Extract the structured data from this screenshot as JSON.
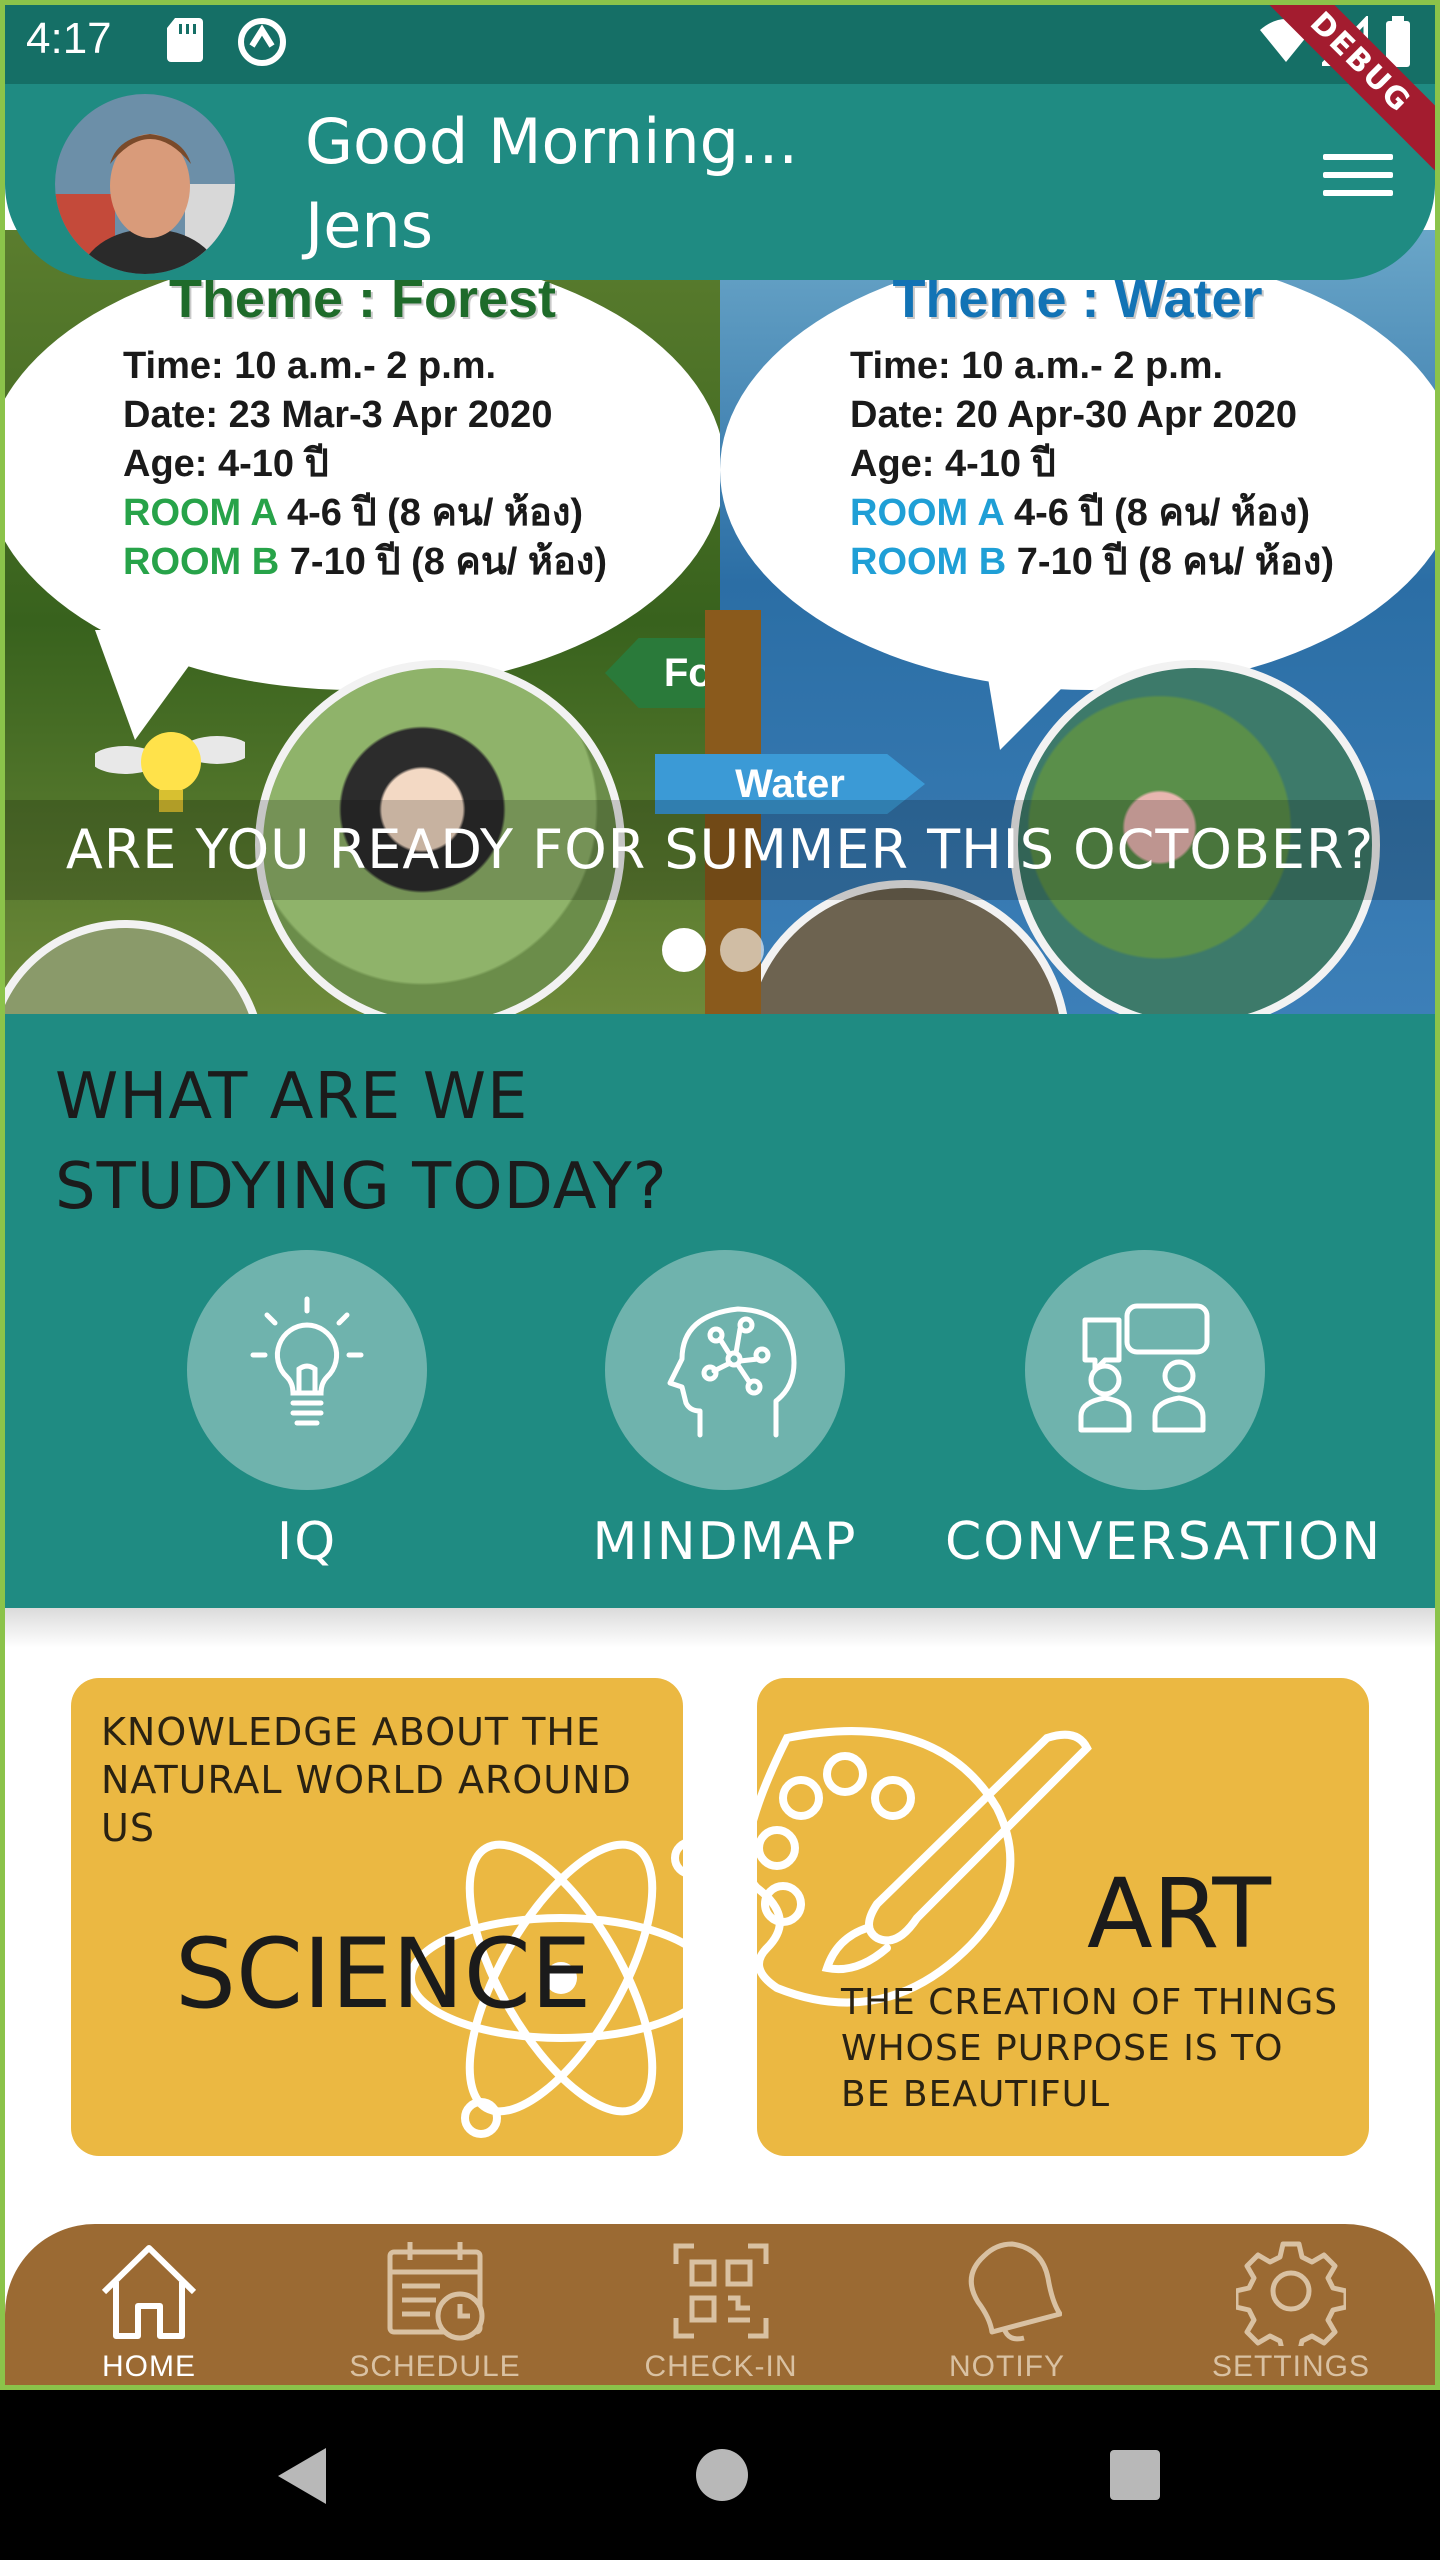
{
  "status_bar": {
    "time": "4:17",
    "icons": [
      "sd-card-icon",
      "sync-icon",
      "wifi-icon",
      "signal-icon",
      "battery-icon"
    ],
    "debug_label": "DEBUG"
  },
  "header": {
    "greeting": "Good Morning...",
    "user_name": "Jens"
  },
  "banner": {
    "caption": "ARE YOU READY FOR SUMMER THIS OCTOBER?",
    "slides_count": 2,
    "active_slide": 0,
    "forest": {
      "title": "Theme : Forest",
      "time": "Time: 10 a.m.- 2 p.m.",
      "date": "Date: 23 Mar-3 Apr 2020",
      "age": "Age: 4-10 ปี",
      "room_a_label": "ROOM A",
      "room_a_text": " 4-6 ปี  (8 คน/ ห้อง)",
      "room_b_label": "ROOM B",
      "room_b_text": " 7-10 ปี (8 คน/ ห้อง)",
      "sign": "Forest"
    },
    "water": {
      "title": "Theme : Water",
      "time": "Time: 10 a.m.- 2 p.m.",
      "date": "Date: 20 Apr-30 Apr 2020",
      "age": "Age: 4-10 ปี",
      "room_a_label": "ROOM A",
      "room_a_text": " 4-6 ปี  (8 คน/ ห้อง)",
      "room_b_label": "ROOM B",
      "room_b_text": " 7-10 ปี (8 คน/ ห้อง)",
      "sign": "Water"
    }
  },
  "study": {
    "heading_line1": "WHAT ARE WE",
    "heading_line2": "STUDYING TODAY?",
    "subjects": [
      {
        "label": "IQ",
        "icon": "lightbulb-icon"
      },
      {
        "label": "MINDMAP",
        "icon": "brain-icon"
      },
      {
        "label": "CONVERSATION",
        "icon": "conversation-icon"
      }
    ]
  },
  "cards": {
    "science": {
      "desc_line1": "KNOWLEDGE ABOUT THE",
      "desc_line2": "NATURAL WORLD AROUND",
      "desc_line3": "US",
      "title": "SCIENCE",
      "icon": "atom-icon"
    },
    "art": {
      "title": "ART",
      "desc_line1": "THE CREATION OF THINGS",
      "desc_line2": "WHOSE PURPOSE IS TO",
      "desc_line3": "BE BEAUTIFUL",
      "icon": "palette-icon"
    }
  },
  "bottom_nav": {
    "items": [
      {
        "label": "HOME",
        "icon": "home-icon",
        "active": true
      },
      {
        "label": "SCHEDULE",
        "icon": "calendar-clock-icon",
        "active": false
      },
      {
        "label": "CHECK-IN",
        "icon": "qr-code-icon",
        "active": false
      },
      {
        "label": "NOTIFY",
        "icon": "bell-icon",
        "active": false
      },
      {
        "label": "SETTINGS",
        "icon": "gear-icon",
        "active": false
      }
    ]
  },
  "colors": {
    "teal": "#1f8b82",
    "teal_dark": "#156f66",
    "card_yellow": "#ebb842",
    "nav_brown": "#9b6a33"
  }
}
